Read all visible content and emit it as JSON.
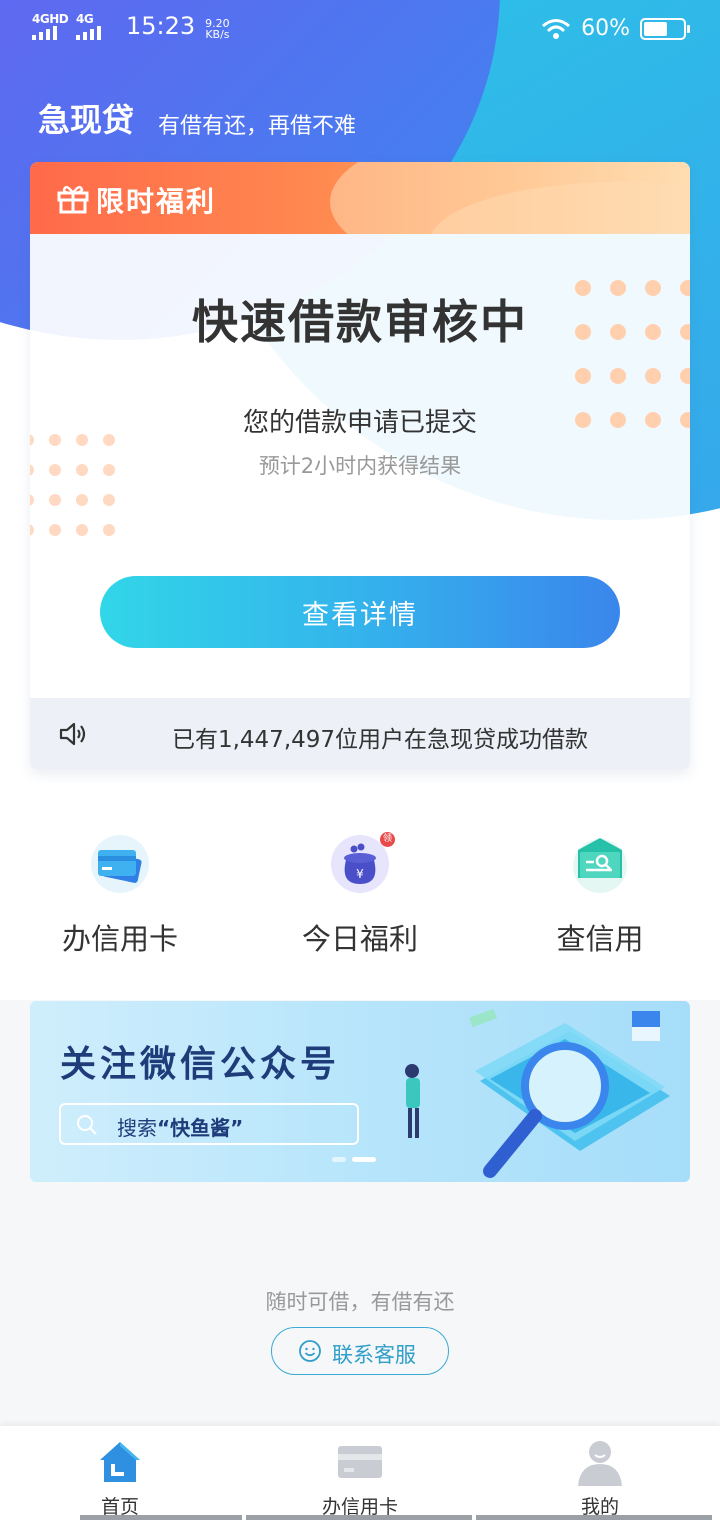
{
  "status_bar": {
    "network1": "4GHD",
    "network2": "4G",
    "time": "15:23",
    "speed_value": "9.20",
    "speed_unit": "KB/s",
    "battery": "60%",
    "icons": [
      "signal-icon",
      "wifi-icon",
      "battery-icon"
    ]
  },
  "header": {
    "app_name": "急现贷",
    "slogan": "有借有还，再借不难"
  },
  "loan_card": {
    "promo_label": "限时福利",
    "status_title": "快速借款审核中",
    "message": "您的借款申请已提交",
    "estimate": "预计2小时内获得结果",
    "detail_button": "查看详情",
    "footer_text": "已有1,447,497位用户在急现贷成功借款",
    "icons": [
      "gift-icon",
      "speaker-icon"
    ]
  },
  "quick_entries": [
    {
      "label": "办信用卡",
      "icon": "credit-card-icon"
    },
    {
      "label": "今日福利",
      "icon": "money-bag-icon",
      "badge": "领"
    },
    {
      "label": "查信用",
      "icon": "credit-search-icon"
    }
  ],
  "banner": {
    "title": "关注微信公众号",
    "search_prefix": "搜索",
    "search_keyword": "“快鱼酱”",
    "pages": 2,
    "active_page": 2
  },
  "footer": {
    "slogan": "随时可借，有借有还",
    "service_button": "联系客服"
  },
  "tab_bar": {
    "items": [
      {
        "label": "首页",
        "icon": "home-icon",
        "active": true
      },
      {
        "label": "办信用卡",
        "icon": "card-icon",
        "active": false
      },
      {
        "label": "我的",
        "icon": "user-icon",
        "active": false
      }
    ]
  },
  "colors": {
    "primary_gradient_start": "#31d6e8",
    "primary_gradient_end": "#3a86ec",
    "promo_orange": "#ff6a4a",
    "banner_title": "#1f3c7a"
  }
}
